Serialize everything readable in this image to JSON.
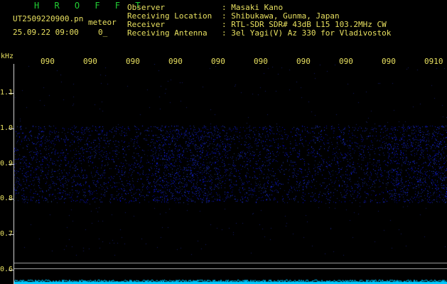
{
  "header": {
    "brand": "H R O F F T",
    "filename": "UT2509220900.pn",
    "mode": "meteor",
    "datetime": "25.09.22 09:00",
    "count": "0_",
    "fields": [
      {
        "label": "Observer",
        "value": ": Masaki Kano"
      },
      {
        "label": "Receiving Location",
        "value": ": Shibukawa, Gunma, Japan"
      },
      {
        "label": "Receiver",
        "value": ": RTL-SDR SDR# 43dB L15 103.2MHz CW"
      },
      {
        "label": "Receiving Antenna",
        "value": ": 3el Yagi(V) Az 330 for Vladivostok"
      }
    ]
  },
  "chart_data": {
    "type": "heatmap",
    "ylabel": "kHz",
    "y_ticks": [
      "1.1",
      "1.0",
      "0.9",
      "0.8",
      "0.7",
      "0.6"
    ],
    "x_ticks": [
      "090",
      "090",
      "090",
      "090",
      "090",
      "090",
      "090",
      "090",
      "090",
      "0910"
    ],
    "ylim": [
      0.59,
      1.16
    ],
    "signal_band_khz": [
      0.8,
      1.0
    ],
    "colors": {
      "background": "#000000",
      "signal": "#2a3cff",
      "baseline": "#00c8ff",
      "axis_text": "#e8e060"
    }
  }
}
